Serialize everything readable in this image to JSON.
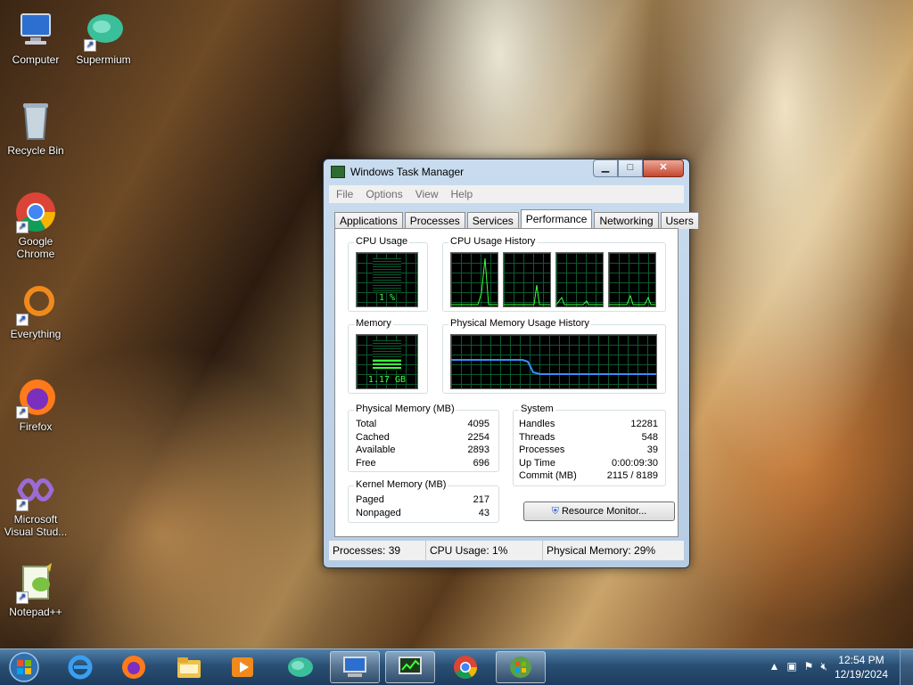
{
  "desktop": {
    "icons": [
      {
        "label": "Computer"
      },
      {
        "label": "Supermium"
      },
      {
        "label": "Recycle Bin"
      },
      {
        "label": "Google Chrome"
      },
      {
        "label": "Everything"
      },
      {
        "label": "Firefox"
      },
      {
        "label": "Microsoft Visual Stud..."
      },
      {
        "label": "Notepad++"
      }
    ]
  },
  "task_manager": {
    "title": "Windows Task Manager",
    "menu": [
      "File",
      "Options",
      "View",
      "Help"
    ],
    "tabs": [
      "Applications",
      "Processes",
      "Services",
      "Performance",
      "Networking",
      "Users"
    ],
    "active_tab": "Performance",
    "cpu_usage": {
      "label": "CPU Usage",
      "value": "1 %"
    },
    "cpu_history": {
      "label": "CPU Usage History"
    },
    "memory": {
      "label": "Memory",
      "value": "1.17 GB"
    },
    "memory_history": {
      "label": "Physical Memory Usage History"
    },
    "physical_memory": {
      "label": "Physical Memory (MB)",
      "rows": [
        {
          "name": "Total",
          "value": "4095"
        },
        {
          "name": "Cached",
          "value": "2254"
        },
        {
          "name": "Available",
          "value": "2893"
        },
        {
          "name": "Free",
          "value": "696"
        }
      ]
    },
    "kernel_memory": {
      "label": "Kernel Memory (MB)",
      "rows": [
        {
          "name": "Paged",
          "value": "217"
        },
        {
          "name": "Nonpaged",
          "value": "43"
        }
      ]
    },
    "system": {
      "label": "System",
      "rows": [
        {
          "name": "Handles",
          "value": "12281"
        },
        {
          "name": "Threads",
          "value": "548"
        },
        {
          "name": "Processes",
          "value": "39"
        },
        {
          "name": "Up Time",
          "value": "0:00:09:30"
        },
        {
          "name": "Commit (MB)",
          "value": "2115 / 8189"
        }
      ]
    },
    "resource_monitor_label": "Resource Monitor...",
    "status": {
      "processes": "Processes: 39",
      "cpu": "CPU Usage: 1%",
      "memory": "Physical Memory: 29%"
    }
  },
  "taskbar": {
    "time": "12:54 PM",
    "date": "12/19/2024"
  },
  "colors": {
    "graph_green": "#3cff3c",
    "graph_grid": "#0b5a2f",
    "memory_line": "#3a8cff",
    "taskbar": "#2a4f74"
  }
}
